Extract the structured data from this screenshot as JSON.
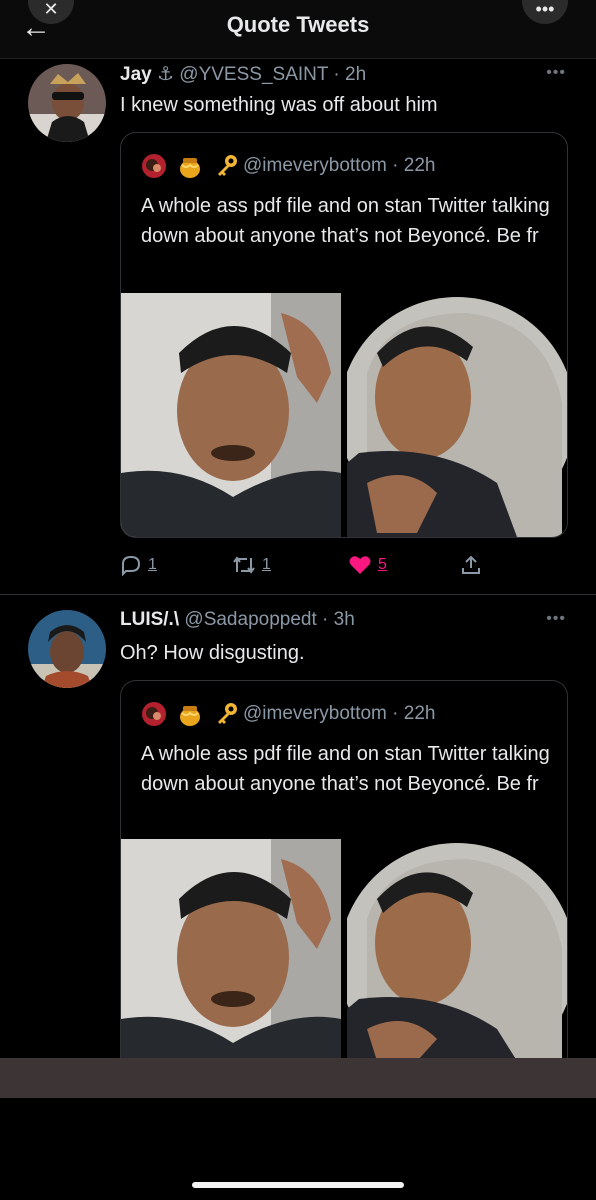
{
  "header": {
    "title": "Quote Tweets"
  },
  "tweets": [
    {
      "name": "Jay",
      "handle": "@YVESS_SAINT",
      "time": "· 2h",
      "text": "I knew something was off about him",
      "quote": {
        "handle": "@imeverybottom",
        "time": "· 22h",
        "text": "A whole ass pdf file and on stan Twitter talking down about anyone that’s not Beyoncé. Be fr"
      },
      "counts": {
        "replies": "1",
        "retweets": "1",
        "likes": "5"
      }
    },
    {
      "name": "LUIS/.\\",
      "handle": "@Sadapoppedt",
      "time": "· 3h",
      "text": "Oh? How disgusting.",
      "quote": {
        "handle": "@imeverybottom",
        "time": "· 22h",
        "text": "A whole ass pdf file and on stan Twitter talking down about anyone that’s not Beyoncé. Be fr"
      }
    }
  ],
  "colors": {
    "like": "#f91880",
    "meta": "#8b98a5",
    "background": "#000000"
  },
  "icons": [
    "back-arrow-icon",
    "more-icon",
    "reply-icon",
    "retweet-icon",
    "heart-icon",
    "share-icon",
    "anchor-icon",
    "honey-pot-icon",
    "key-icon"
  ]
}
